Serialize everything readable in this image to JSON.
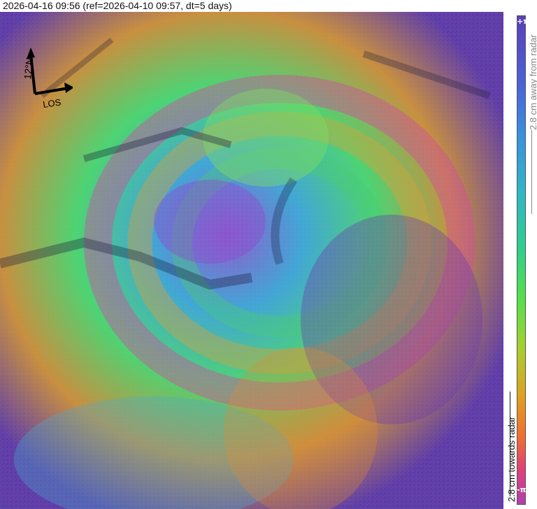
{
  "title": "2026-04-16 09:56 (ref=2026-04-10 09:57, dt=5 days)",
  "compass": {
    "north_label": "12°N",
    "los_label": "LOS"
  },
  "colorbar": {
    "top_label": "+π",
    "bottom_label": "-π",
    "away_label": "2.8 cm away from radar",
    "towards_label": "2.8 cm towards radar"
  }
}
